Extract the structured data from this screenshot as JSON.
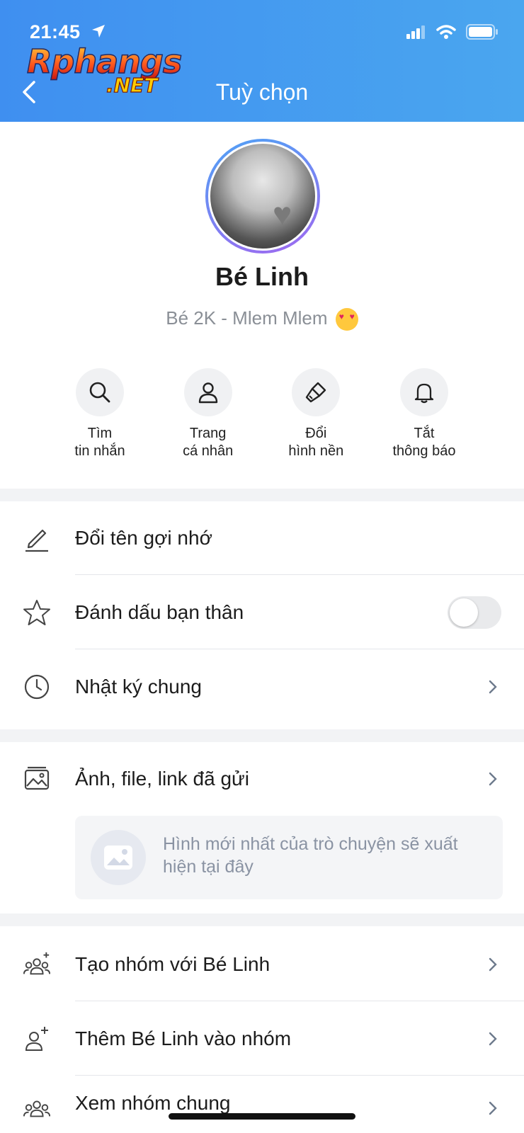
{
  "status_bar": {
    "time": "21:45"
  },
  "watermark": {
    "main": "Rphangs",
    "sub": ".NET"
  },
  "header": {
    "title": "Tuỳ chọn"
  },
  "profile": {
    "name": "Bé Linh",
    "status": "Bé 2K - Mlem Mlem"
  },
  "quick_actions": [
    {
      "line1": "Tìm",
      "line2": "tin nhắn",
      "icon": "search-icon"
    },
    {
      "line1": "Trang",
      "line2": "cá nhân",
      "icon": "person-icon"
    },
    {
      "line1": "Đổi",
      "line2": "hình nền",
      "icon": "paintbrush-icon"
    },
    {
      "line1": "Tắt",
      "line2": "thông báo",
      "icon": "bell-icon"
    }
  ],
  "section1": {
    "rename": "Đổi tên gợi nhớ",
    "best_friend": "Đánh dấu bạn thân",
    "best_friend_on": false,
    "diary": "Nhật ký chung"
  },
  "section2": {
    "media": "Ảnh, file, link đã gửi",
    "media_placeholder": "Hình mới nhất của trò chuyện sẽ xuất hiện tại đây"
  },
  "section3": {
    "create_group": "Tạo nhóm với Bé Linh",
    "add_to_group": "Thêm Bé Linh vào nhóm",
    "common_groups": "Xem nhóm chung"
  },
  "colors": {
    "header_start": "#3f8ff0",
    "header_end": "#4aa6ef",
    "separator": "#f2f3f5"
  }
}
